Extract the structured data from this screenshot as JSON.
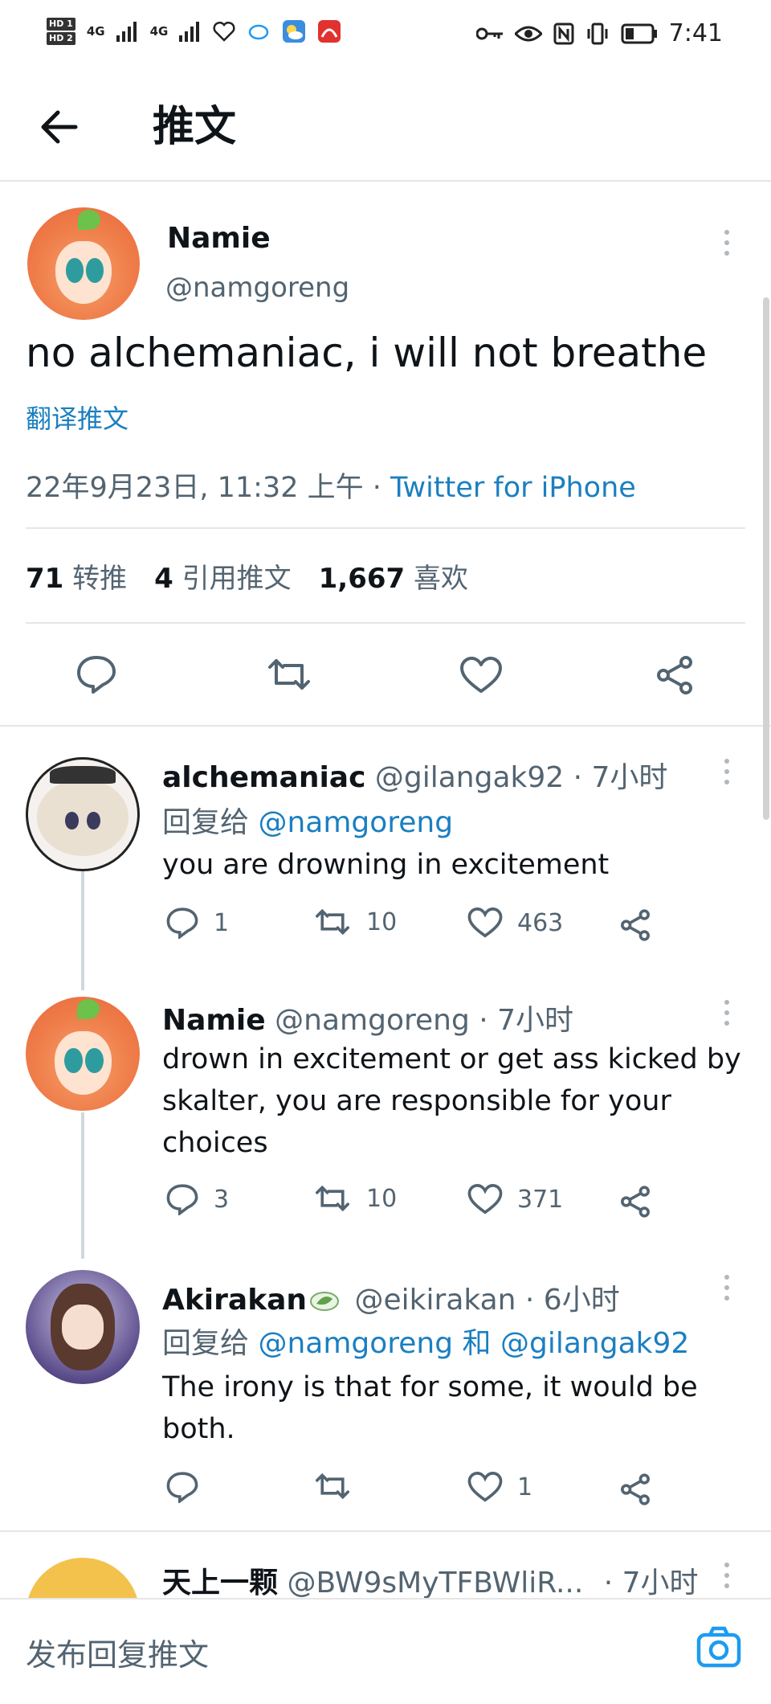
{
  "status_bar": {
    "hd1": "HD 1",
    "hd2": "HD 2",
    "net1": "4G",
    "net2": "4G",
    "time": "7:41"
  },
  "header": {
    "title": "推文"
  },
  "main_tweet": {
    "name": "Namie",
    "handle": "@namgoreng",
    "text": "no alchemaniac, i will not breathe",
    "translate": "翻译推文",
    "timestamp": "22年9月23日, 11:32 上午 · ",
    "source": "Twitter for iPhone",
    "stats": [
      {
        "count": "71",
        "label": "转推"
      },
      {
        "count": "4",
        "label": "引用推文"
      },
      {
        "count": "1,667",
        "label": "喜欢"
      }
    ]
  },
  "replies": [
    {
      "name": "alchemaniac",
      "handle": "@gilangak92 · 7小时",
      "reply_prefix": "回复给 ",
      "reply_to": "@namgoreng",
      "text": "you are drowning in excitement",
      "replies": "1",
      "retweets": "10",
      "likes": "463"
    },
    {
      "name": "Namie",
      "handle": "@namgoreng · 7小时",
      "text_lines": [
        "drown in excitement or get ass kicked by",
        "skalter, you are responsible for your",
        "choices"
      ],
      "replies": "3",
      "retweets": "10",
      "likes": "371"
    },
    {
      "name": "Akirakan",
      "handle": "@eikirakan · 6小时",
      "reply_prefix": "回复给 ",
      "reply_to": "@namgoreng 和 @gilangak92",
      "text_lines": [
        "The irony is that for some, it would be",
        "both."
      ],
      "replies": "",
      "retweets": "",
      "likes": "1"
    },
    {
      "name": "天上一颗",
      "handle": "@BW9sMyTFBWliR...",
      "time": "· 7小时"
    }
  ],
  "composer": {
    "placeholder": "发布回复推文"
  },
  "colors": {
    "accent": "#1d9bf0",
    "text": "#0f1419",
    "secondary": "#536471"
  }
}
